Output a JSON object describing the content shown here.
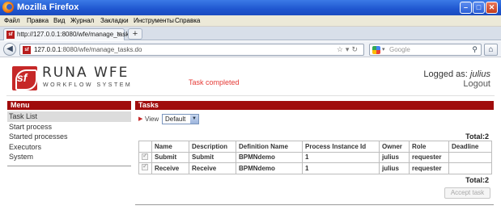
{
  "window": {
    "title": "Mozilla Firefox"
  },
  "menubar": [
    "Файл",
    "Правка",
    "Вид",
    "Журнал",
    "Закладки",
    "Инструменты",
    "Справка"
  ],
  "tab": {
    "label": "http://127.0.0.1:8080/wfe/manage_tasks.do"
  },
  "url": {
    "host": "127.0.0.1",
    "rest": ":8080/wfe/manage_tasks.do"
  },
  "search": {
    "placeholder": "Google"
  },
  "logo": {
    "mark": "sf",
    "title": "RUNA WFE",
    "subtitle": "WORKFLOW SYSTEM"
  },
  "status_message": "Task completed",
  "user": {
    "logged_as_label": "Logged as: ",
    "name": "julius",
    "logout": "Logout"
  },
  "menu": {
    "header": "Menu",
    "items": [
      "Task List",
      "Start process",
      "Started processes",
      "Executors",
      "System"
    ]
  },
  "tasks": {
    "header": "Tasks",
    "view_label": "View",
    "view_value": "Default",
    "total": "Total:2",
    "columns": [
      "",
      "Name",
      "Description",
      "Definition Name",
      "Process Instance Id",
      "Owner",
      "Role",
      "Deadline"
    ],
    "rows": [
      [
        "",
        "Submit",
        "Submit",
        "BPMNdemo",
        "1",
        "julius",
        "requester",
        ""
      ],
      [
        "",
        "Receive",
        "Receive",
        "BPMNdemo",
        "1",
        "julius",
        "requester",
        ""
      ]
    ],
    "accept_button": "Accept task"
  }
}
